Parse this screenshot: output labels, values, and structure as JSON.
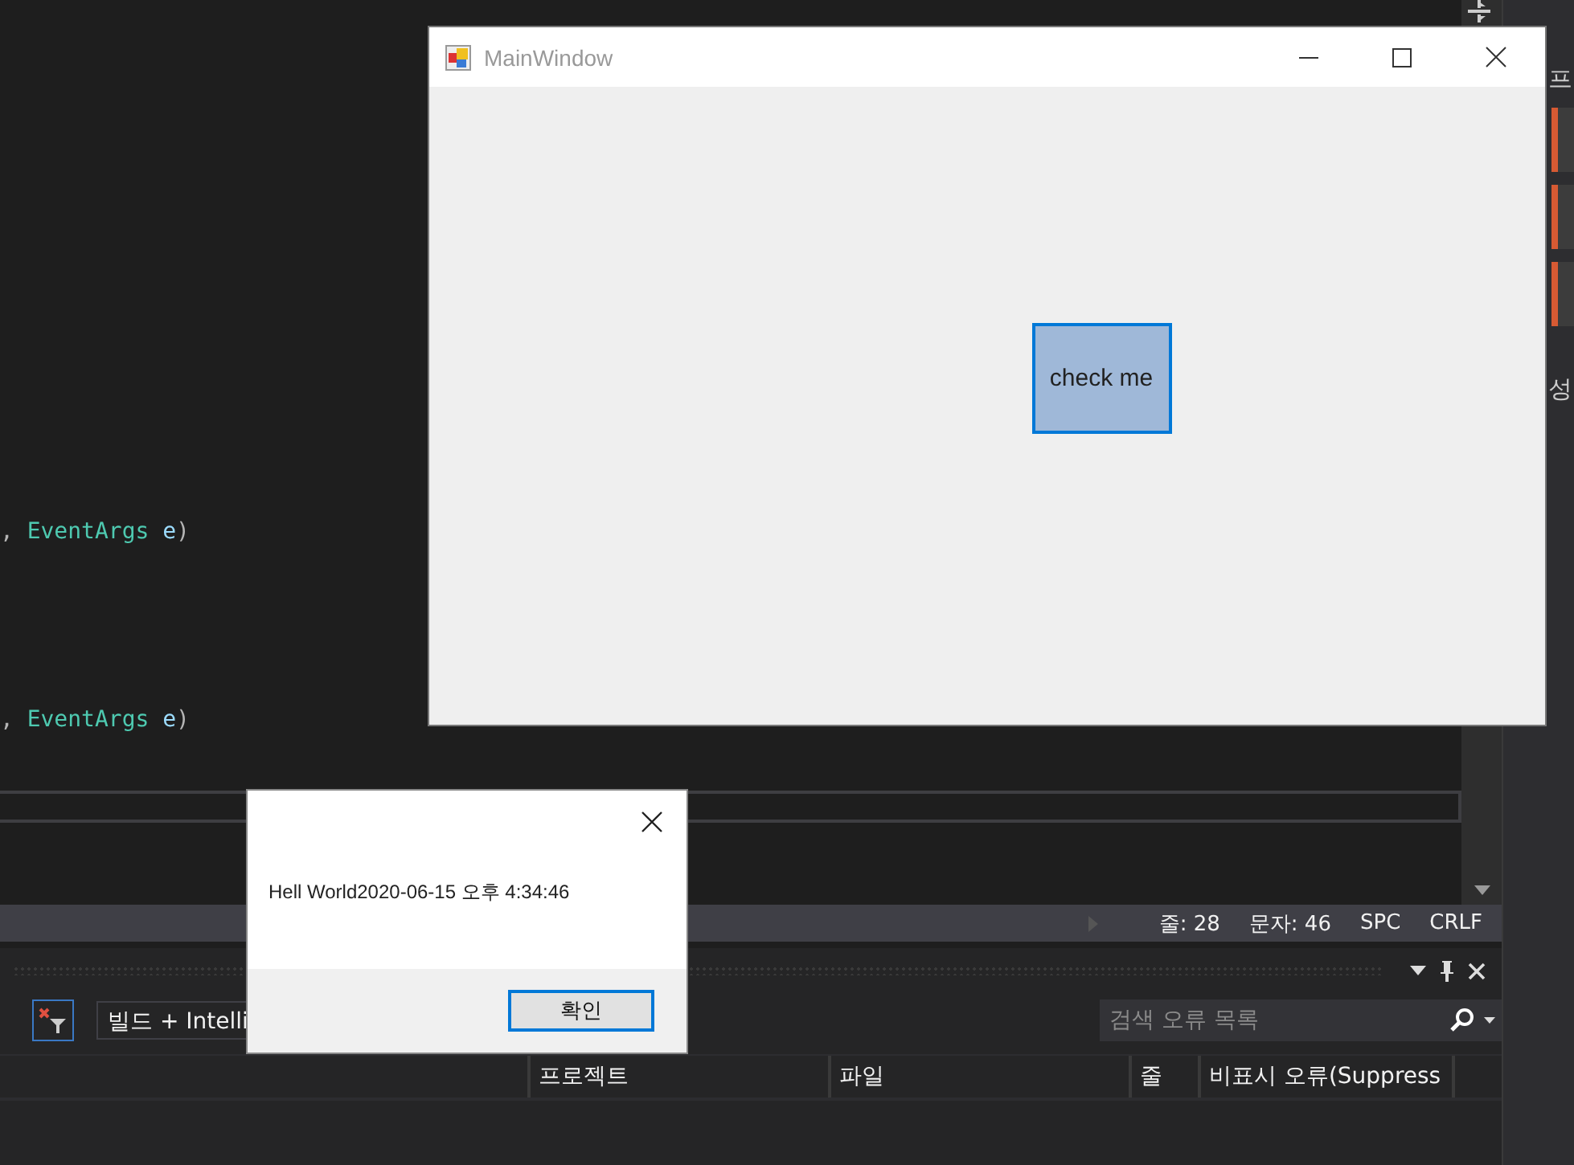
{
  "editor": {
    "code_lines": [
      {
        "tokens": [
          {
            "text": ",",
            "kind": "punct"
          },
          {
            "text": "EventArgs",
            "kind": "type"
          },
          {
            "text": "e",
            "kind": "param"
          },
          {
            "text": ")",
            "kind": "close"
          }
        ]
      },
      {
        "tokens": [
          {
            "text": ",",
            "kind": "punct"
          },
          {
            "text": "EventArgs",
            "kind": "type"
          },
          {
            "text": "e",
            "kind": "param"
          },
          {
            "text": ")",
            "kind": "close"
          }
        ]
      }
    ]
  },
  "status_bar": {
    "items": [
      "줄: 28",
      "문자: 46",
      "SPC",
      "CRLF"
    ]
  },
  "error_list": {
    "scope_dropdown": "빌드 + Intelli",
    "search": {
      "placeholder": "검색 오류 목록"
    },
    "columns": [
      "프로젝트",
      "파일",
      "줄",
      "비표시 오류(Suppress"
    ]
  },
  "side_panel": {
    "labels": [
      "프",
      "성"
    ]
  },
  "main_window": {
    "title": "MainWindow",
    "button": {
      "label": "check me",
      "focused": true
    }
  },
  "message_box": {
    "message": "Hell World2020-06-15 오후 4:34:46",
    "button": "확인"
  }
}
